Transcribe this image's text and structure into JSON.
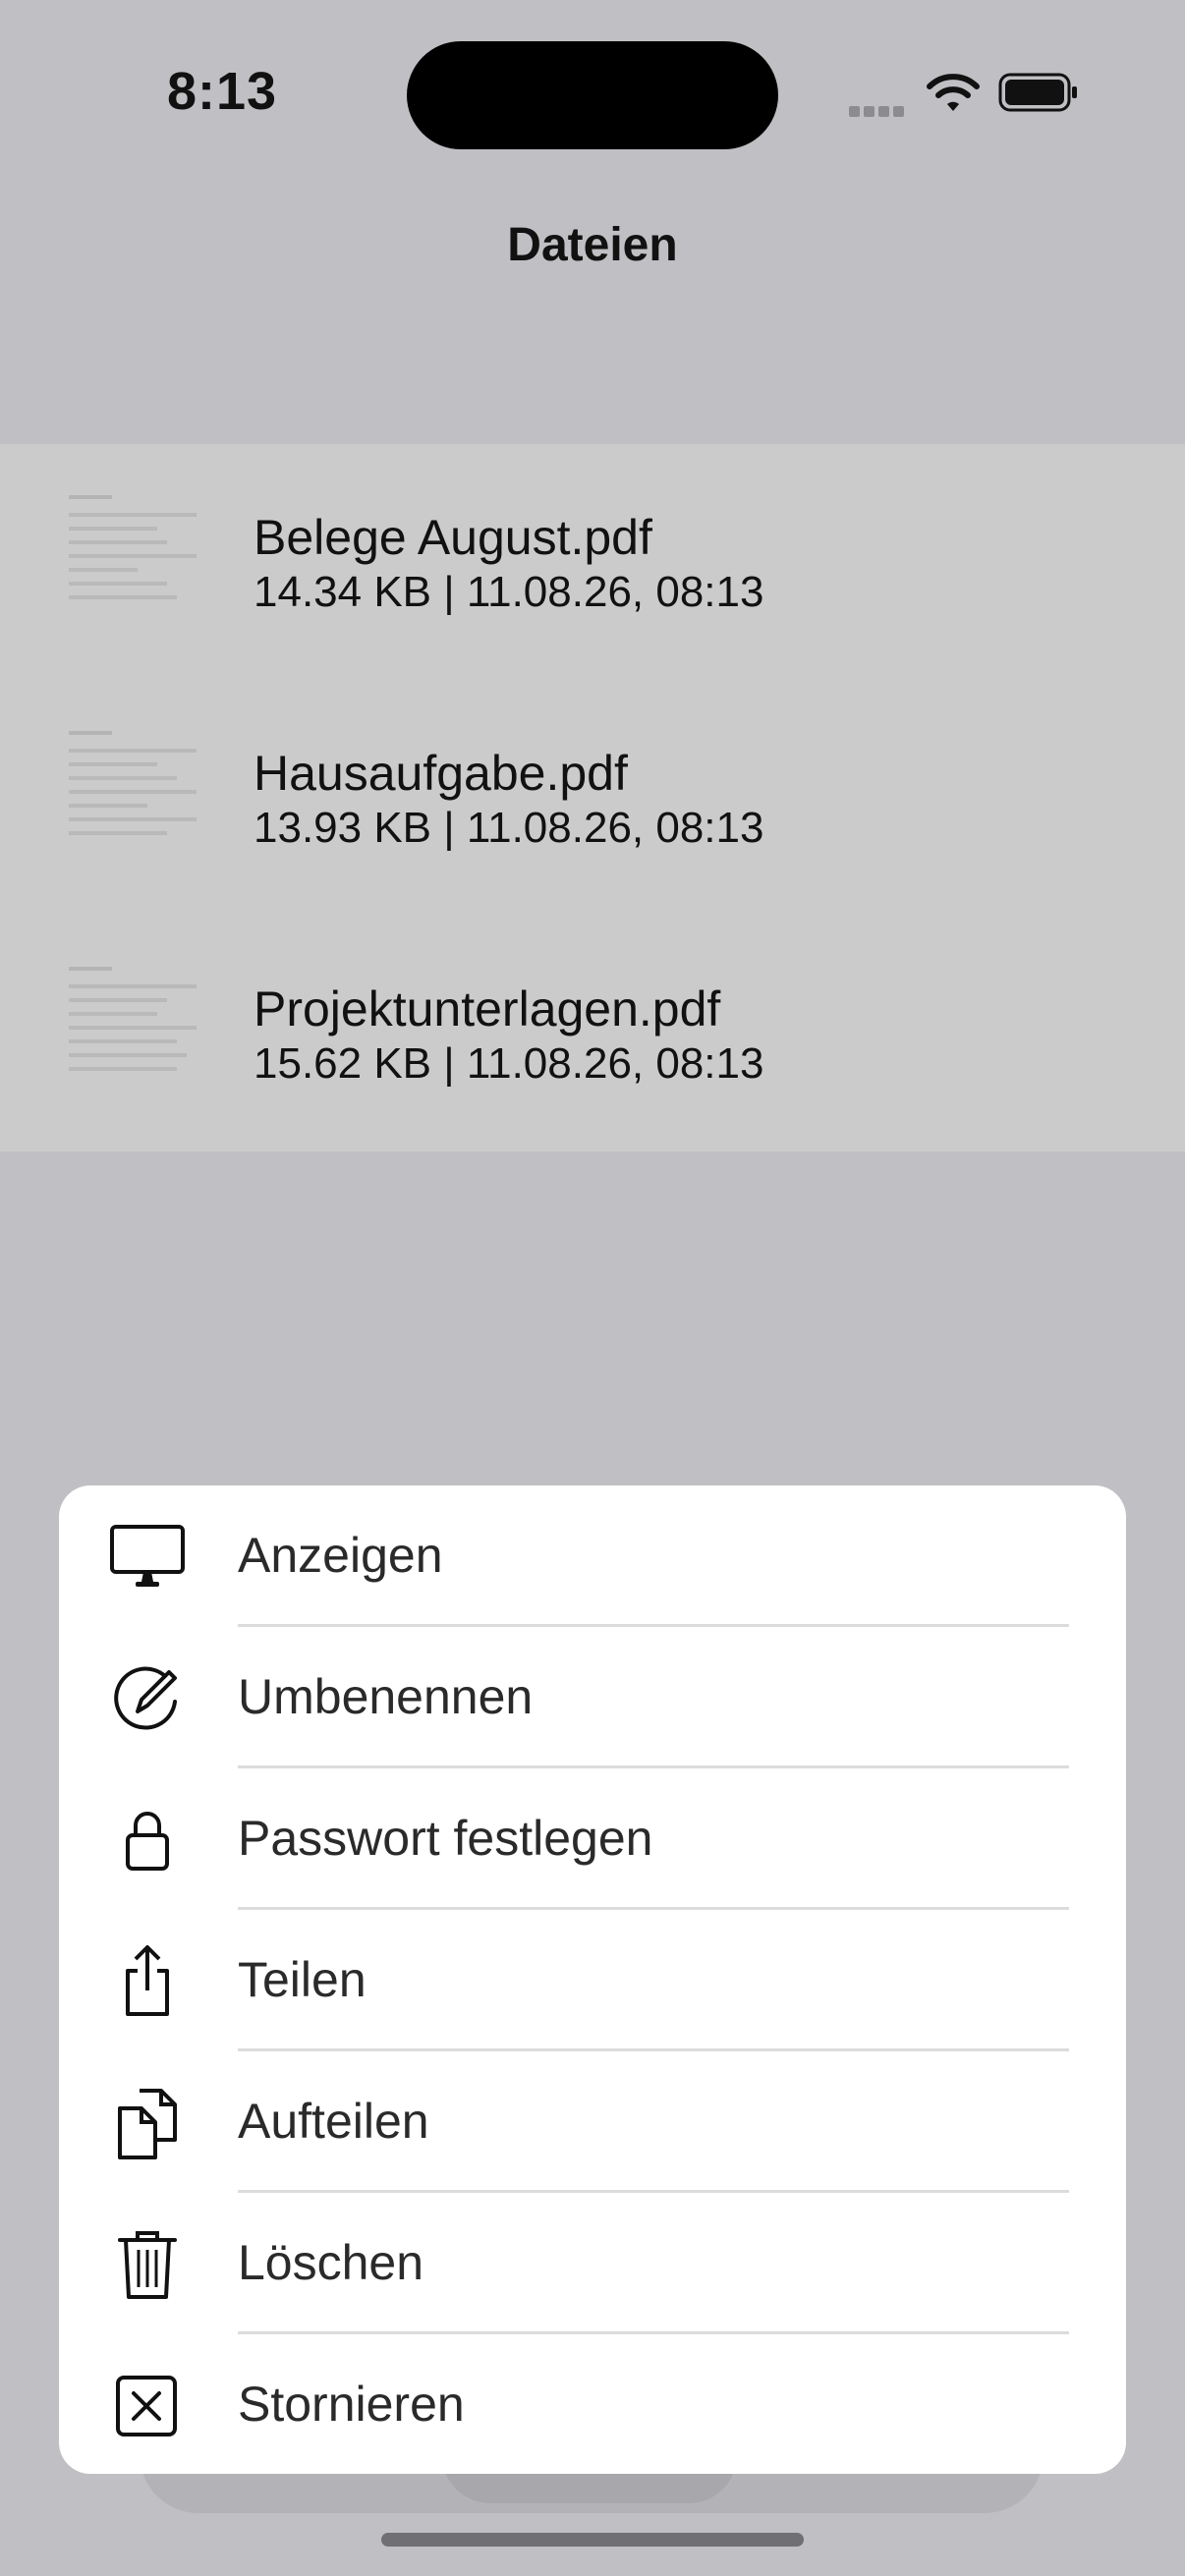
{
  "status_bar": {
    "time": "8:13"
  },
  "header": {
    "title": "Dateien"
  },
  "files": [
    {
      "name": "Belege August.pdf",
      "meta": "14.34 KB | 11.08.26, 08:13"
    },
    {
      "name": "Hausaufgabe.pdf",
      "meta": "13.93 KB | 11.08.26, 08:13"
    },
    {
      "name": "Projektunterlagen.pdf",
      "meta": "15.62 KB | 11.08.26, 08:13"
    }
  ],
  "action_sheet": {
    "items": [
      {
        "label": "Anzeigen",
        "icon": "display-icon"
      },
      {
        "label": "Umbenennen",
        "icon": "pencil-circle-icon"
      },
      {
        "label": "Passwort festlegen",
        "icon": "lock-icon"
      },
      {
        "label": "Teilen",
        "icon": "share-icon"
      },
      {
        "label": "Aufteilen",
        "icon": "split-documents-icon"
      },
      {
        "label": "Löschen",
        "icon": "trash-icon"
      },
      {
        "label": "Stornieren",
        "icon": "xmark-square-icon"
      }
    ]
  }
}
